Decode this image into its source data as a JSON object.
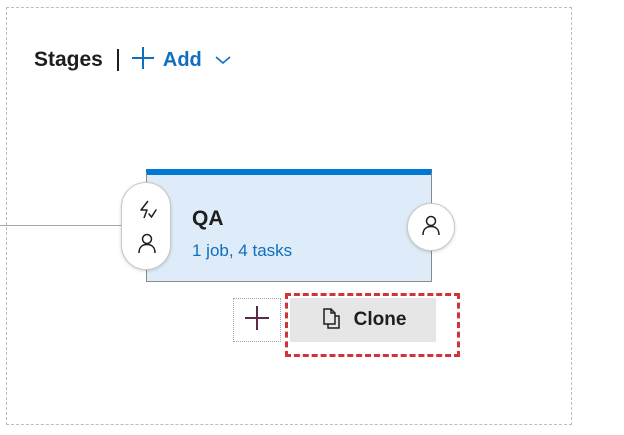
{
  "header": {
    "title": "Stages",
    "add_label": "Add"
  },
  "stage": {
    "name": "QA",
    "summary": "1 job, 4 tasks"
  },
  "actions": {
    "clone_label": "Clone"
  },
  "icons": {
    "add": "plus-icon",
    "dropdown": "chevron-down-icon",
    "pre_deploy_trigger": "lightning-icon",
    "pre_deploy_approver": "person-icon",
    "post_deploy_approver": "person-icon",
    "add_stage": "plus-icon",
    "clone": "copy-icon"
  },
  "colors": {
    "accent": "#0078d4",
    "link": "#106ebe",
    "card_fill": "#deecf9",
    "highlight": "#d13438"
  }
}
